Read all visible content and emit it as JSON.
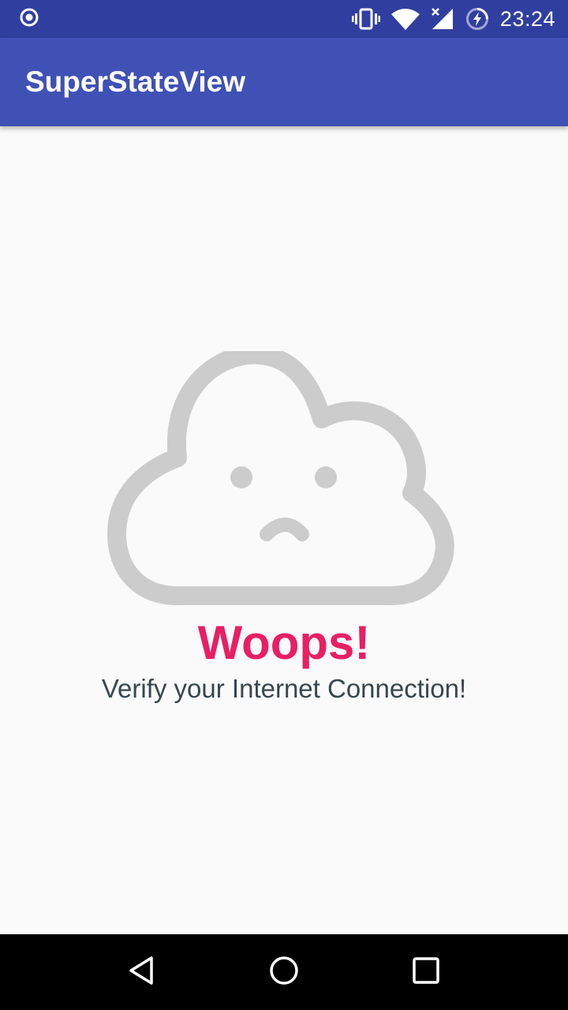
{
  "status_bar": {
    "time": "23:24",
    "icons": [
      "record-icon",
      "vibrate-icon",
      "wifi-icon",
      "cellular-no-signal-icon",
      "battery-charging-icon"
    ]
  },
  "app_bar": {
    "title": "SuperStateView",
    "color": "#3f51b5"
  },
  "state": {
    "icon": "sad-cloud-icon",
    "title": "Woops!",
    "description": "Verify your Internet Connection!",
    "title_color": "#e91e63",
    "icon_color": "#cccccc"
  },
  "nav_bar": {
    "buttons": [
      "back-icon",
      "home-icon",
      "recents-icon"
    ]
  }
}
